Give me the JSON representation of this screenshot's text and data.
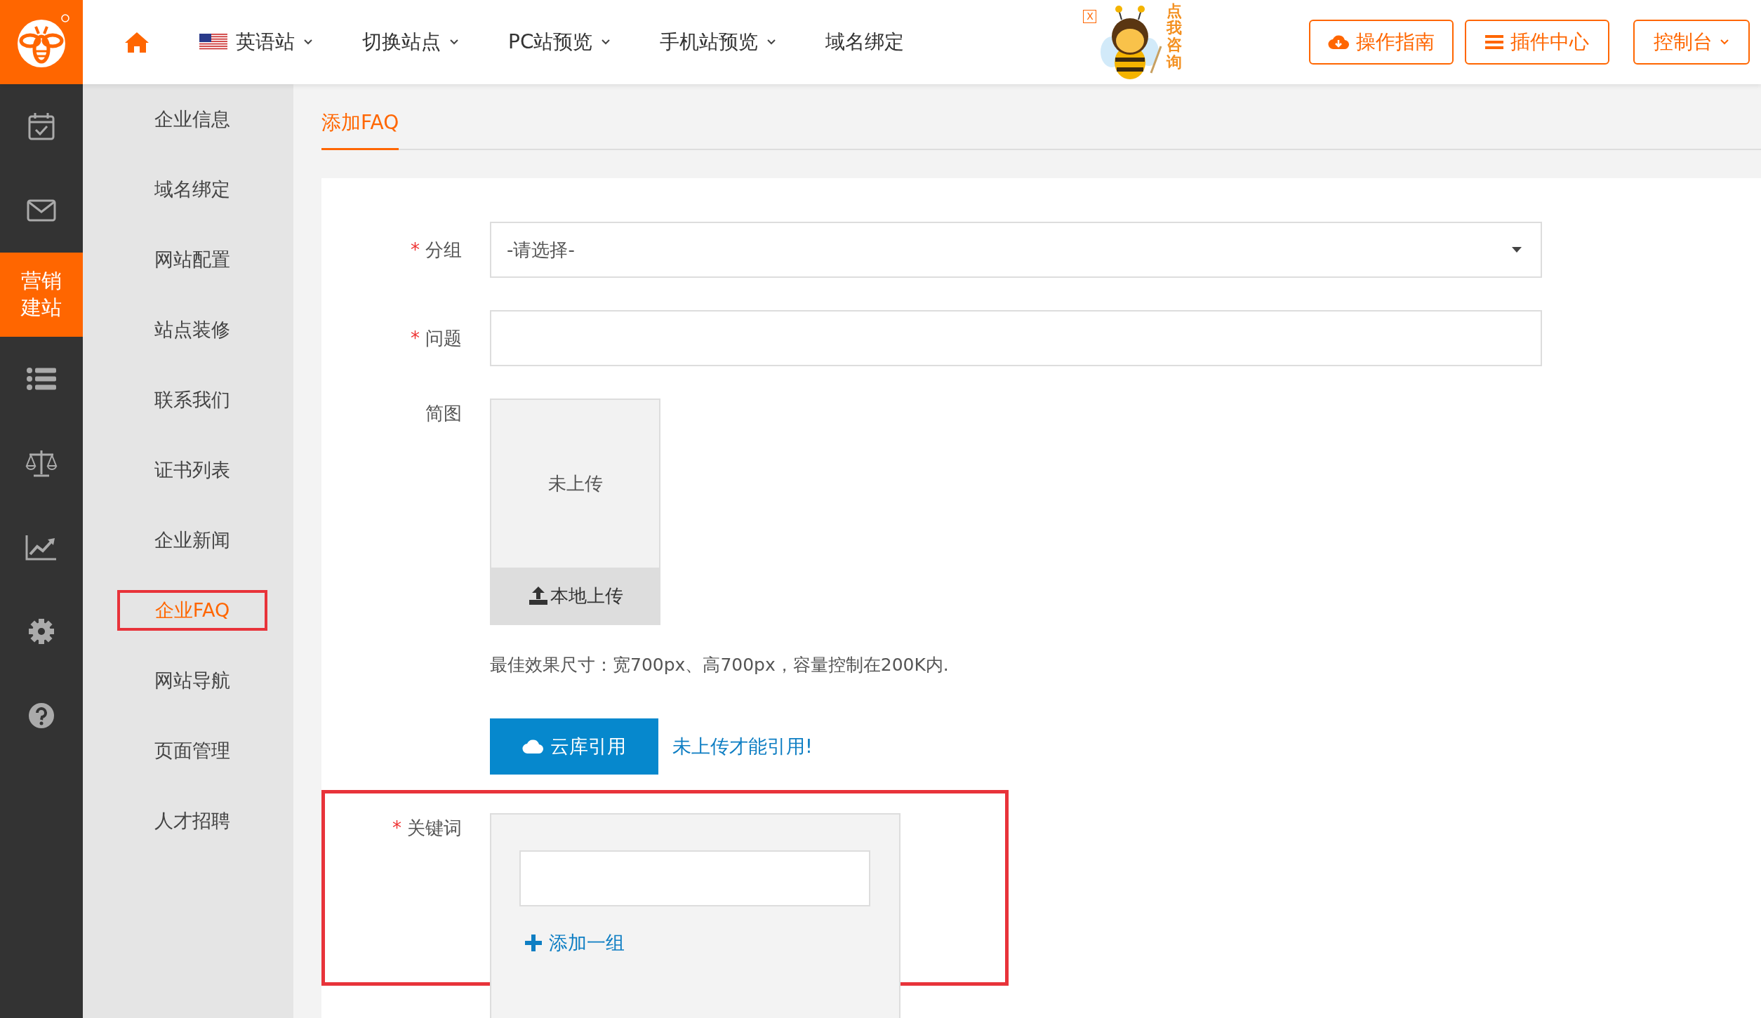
{
  "topbar": {
    "nav": [
      {
        "label": "英语站",
        "kind": "flag-dropdown"
      },
      {
        "label": "切换站点",
        "kind": "dropdown"
      },
      {
        "label": "PC站预览",
        "kind": "dropdown"
      },
      {
        "label": "手机站预览",
        "kind": "dropdown"
      },
      {
        "label": "域名绑定",
        "kind": "link"
      }
    ],
    "consult_text": "点我咨询",
    "consult_close": "X",
    "buttons": [
      {
        "label": "操作指南",
        "kind": "cloud"
      },
      {
        "label": "插件中心",
        "kind": "list"
      },
      {
        "label": "控制台",
        "kind": "dropdown"
      }
    ]
  },
  "rail": [
    {
      "kind": "calendar",
      "selected": false
    },
    {
      "kind": "mail",
      "selected": false
    },
    {
      "kind": "text",
      "label": "营销建站",
      "selected": true
    },
    {
      "kind": "list",
      "selected": false
    },
    {
      "kind": "scales",
      "selected": false
    },
    {
      "kind": "chart",
      "selected": false
    },
    {
      "kind": "gear",
      "selected": false
    },
    {
      "kind": "help",
      "selected": false
    }
  ],
  "sidebar": {
    "items": [
      {
        "label": "企业信息",
        "selected": false,
        "highlighted": false
      },
      {
        "label": "域名绑定",
        "selected": false,
        "highlighted": false
      },
      {
        "label": "网站配置",
        "selected": false,
        "highlighted": false
      },
      {
        "label": "站点装修",
        "selected": false,
        "highlighted": false
      },
      {
        "label": "联系我们",
        "selected": false,
        "highlighted": false
      },
      {
        "label": "证书列表",
        "selected": false,
        "highlighted": false
      },
      {
        "label": "企业新闻",
        "selected": false,
        "highlighted": false
      },
      {
        "label": "企业FAQ",
        "selected": true,
        "highlighted": true
      },
      {
        "label": "网站导航",
        "selected": false,
        "highlighted": false
      },
      {
        "label": "页面管理",
        "selected": false,
        "highlighted": false
      },
      {
        "label": "人才招聘",
        "selected": false,
        "highlighted": false
      }
    ]
  },
  "tabs": [
    {
      "label": "添加FAQ",
      "selected": true
    }
  ],
  "form": {
    "group": {
      "label": "分组",
      "required": true,
      "required_mark": "*",
      "value": "-请选择-"
    },
    "question": {
      "label": "问题",
      "required": true,
      "required_mark": "*"
    },
    "image": {
      "label": "简图",
      "status": "未上传",
      "upload_button": "本地上传",
      "hint": "最佳效果尺寸：宽700px、高700px，容量控制在200K内.",
      "cloud_button": "云库引用",
      "cloud_note": "未上传才能引用!"
    },
    "keywords": {
      "label": "关键词",
      "required": true,
      "required_mark": "*",
      "highlighted": true,
      "add_link": "添加一组"
    }
  }
}
